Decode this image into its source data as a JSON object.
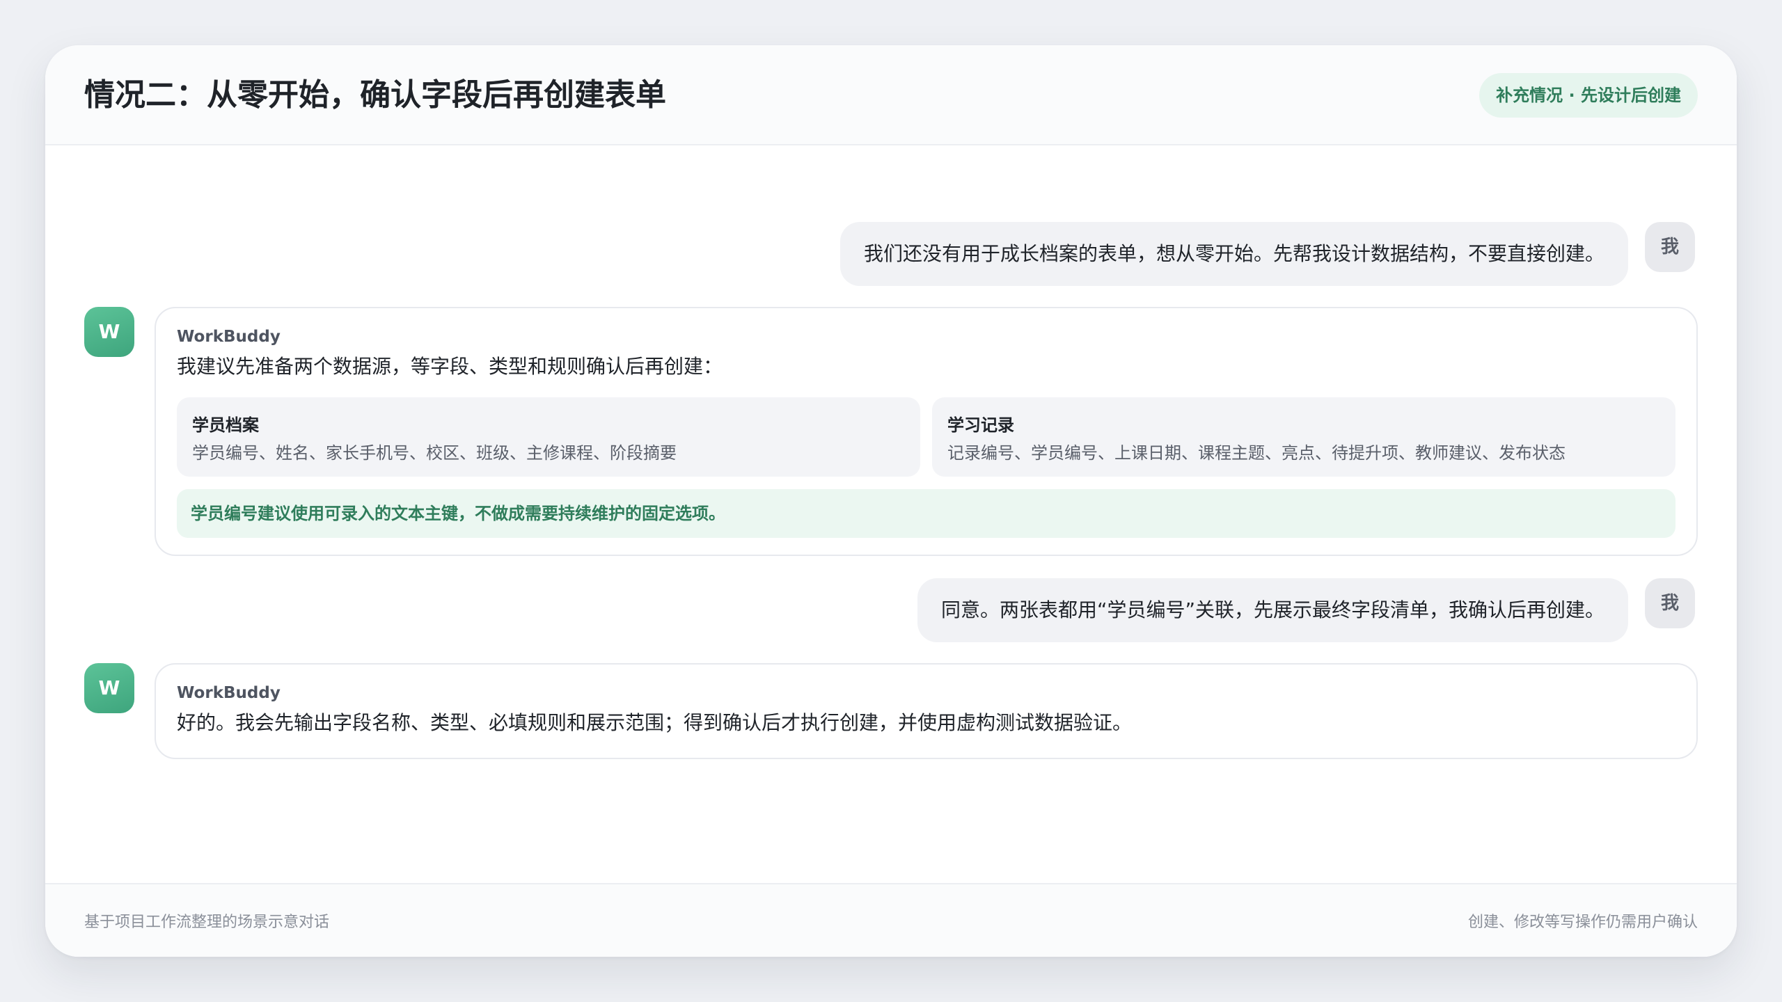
{
  "header": {
    "title": "情况二：从零开始，确认字段后再创建表单",
    "tag": "补充情况 · 先设计后创建"
  },
  "avatars": {
    "user": "我",
    "bot": "W"
  },
  "messages": {
    "user_1": "我们还没有用于成长档案的表单，想从零开始。先帮我设计数据结构，不要直接创建。",
    "bot_1": {
      "sender": "WorkBuddy",
      "text": "我建议先准备两个数据源，等字段、类型和规则确认后再创建：",
      "sources": [
        {
          "title": "学员档案",
          "fields": "学员编号、姓名、家长手机号、校区、班级、主修课程、阶段摘要"
        },
        {
          "title": "学习记录",
          "fields": "记录编号、学员编号、上课日期、课程主题、亮点、待提升项、教师建议、发布状态"
        }
      ],
      "note": "学员编号建议使用可录入的文本主键，不做成需要持续维护的固定选项。"
    },
    "user_2": "同意。两张表都用“学员编号”关联，先展示最终字段清单，我确认后再创建。",
    "bot_2": {
      "sender": "WorkBuddy",
      "text": "好的。我会先输出字段名称、类型、必填规则和展示范围；得到确认后才执行创建，并使用虚构测试数据验证。"
    }
  },
  "footer": {
    "left": "基于项目工作流整理的场景示意对话",
    "right": "创建、修改等写操作仍需用户确认"
  },
  "colors": {
    "accent_green": "#3ea57d",
    "tag_bg": "#e6f5ee",
    "note_text": "#2f7d5b"
  }
}
